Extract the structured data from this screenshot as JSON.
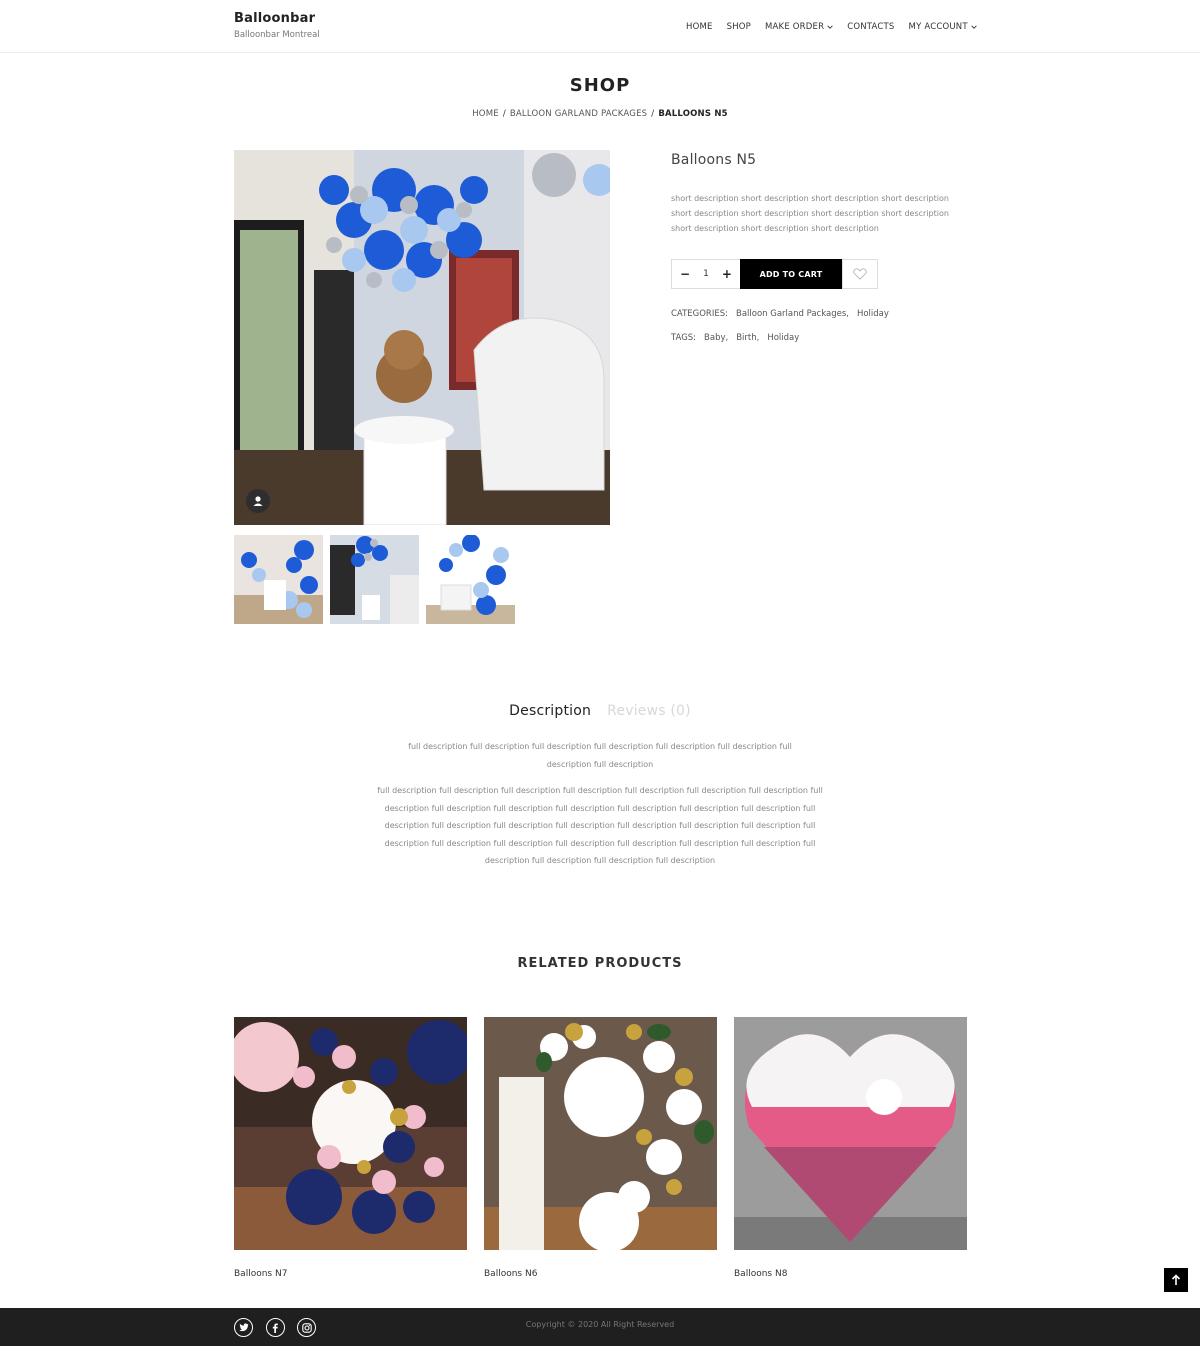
{
  "header": {
    "brand_name": "Balloonbar",
    "brand_sub": "Balloonbar Montreal",
    "nav": [
      {
        "label": "HOME"
      },
      {
        "label": "SHOP"
      },
      {
        "label": "MAKE ORDER"
      },
      {
        "label": "CONTACTS"
      },
      {
        "label": "MY ACCOUNT"
      }
    ]
  },
  "page": {
    "title": "SHOP",
    "breadcrumb": [
      "HOME",
      "BALLOON GARLAND PACKAGES",
      "BALLOONS N5"
    ]
  },
  "product": {
    "title": "Balloons N5",
    "short_description": "short description short description short description short description short description short description short description short description short description short description short description",
    "quantity": "1",
    "qty_minus": "−",
    "qty_plus": "+",
    "add_to_cart": "ADD TO CART",
    "categories_label": "CATEGORIES:",
    "categories": [
      "Balloon Garland Packages,",
      "Holiday"
    ],
    "tags_label": "TAGS:",
    "tags": [
      "Baby,",
      "Birth,",
      "Holiday"
    ]
  },
  "tabs": {
    "description": "Description",
    "reviews": "Reviews (0)"
  },
  "description": {
    "paragraph1": "full description full description full description full description full description full description full description full description",
    "paragraph2": "full description full description full description full description full description full description full description full description full description full description full description full description full description full description full description full description full description full description full description full description full description full description  full description full description full description full description full description full description full description full description full description full description"
  },
  "related": {
    "title": "RELATED PRODUCTS",
    "items": [
      {
        "name": "Balloons N7"
      },
      {
        "name": "Balloons N6"
      },
      {
        "name": "Balloons N8"
      }
    ]
  },
  "footer": {
    "copyright": "Copyright © 2020 All Right Reserved"
  },
  "icons": [
    "chevron-down-icon",
    "user-icon",
    "heart-icon",
    "arrow-up-icon",
    "twitter-icon",
    "facebook-icon",
    "instagram-icon"
  ]
}
